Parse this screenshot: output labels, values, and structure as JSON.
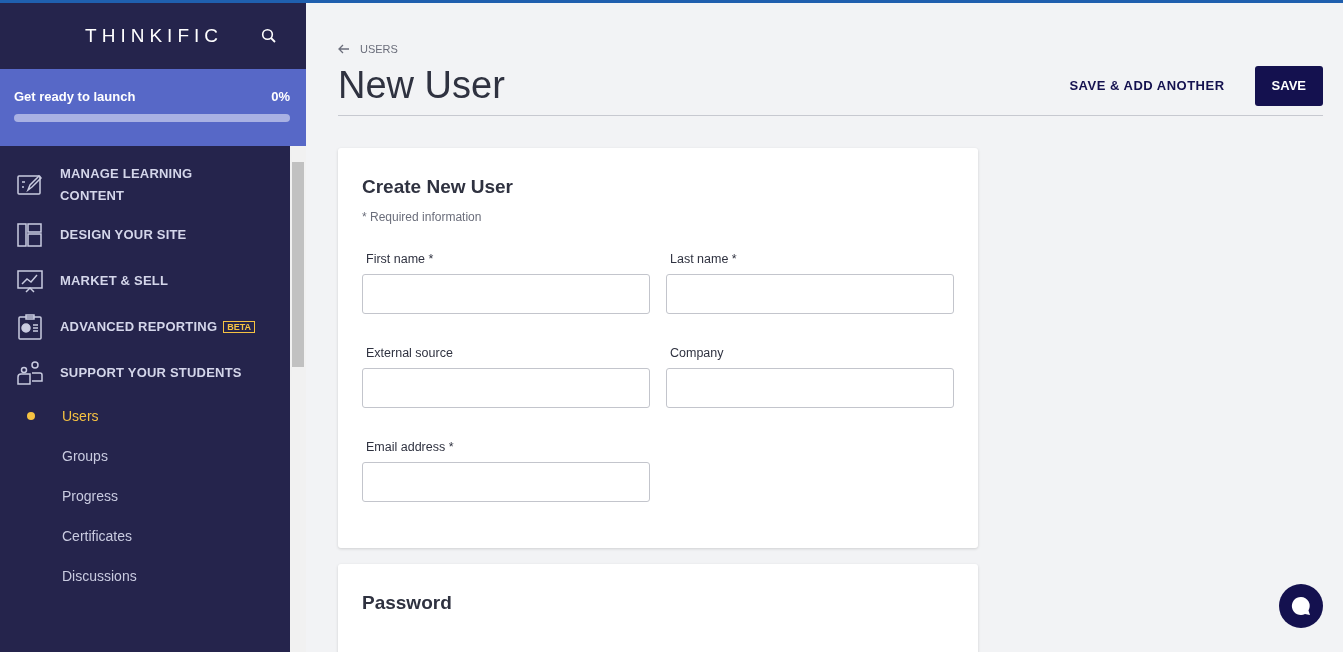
{
  "sidebar": {
    "logo": "THINKIFIC",
    "launch": {
      "label": "Get ready to launch",
      "percent": "0%",
      "level": 0
    },
    "sections": [
      {
        "label": "MANAGE LEARNING CONTENT"
      },
      {
        "label": "DESIGN YOUR SITE"
      },
      {
        "label": "MARKET & SELL"
      },
      {
        "label": "ADVANCED REPORTING",
        "badge": "BETA"
      },
      {
        "label": "SUPPORT YOUR STUDENTS",
        "children": [
          {
            "label": "Users",
            "selected": true
          },
          {
            "label": "Groups",
            "selected": false
          },
          {
            "label": "Progress",
            "selected": false
          },
          {
            "label": "Certificates",
            "selected": false
          },
          {
            "label": "Discussions",
            "selected": false
          }
        ]
      }
    ]
  },
  "breadcrumb": "USERS",
  "page_title": "New User",
  "actions": {
    "secondary": "SAVE & ADD ANOTHER",
    "primary": "SAVE"
  },
  "form": {
    "title": "Create New User",
    "note": "* Required information",
    "fields": [
      {
        "label": "First name *"
      },
      {
        "label": "Last name *"
      },
      {
        "label": "External source"
      },
      {
        "label": "Company"
      },
      {
        "label": "Email address *"
      }
    ]
  },
  "password_card": {
    "title": "Password"
  }
}
